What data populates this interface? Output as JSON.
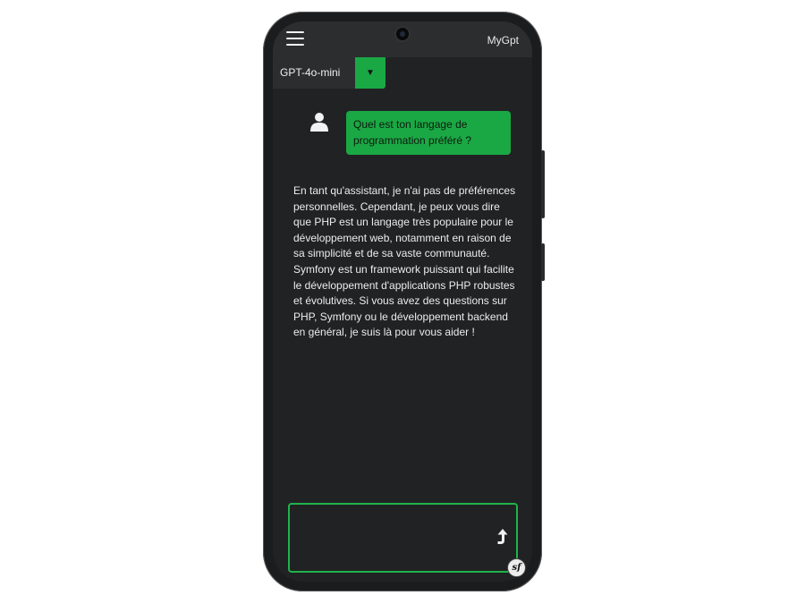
{
  "header": {
    "title": "MyGpt",
    "menu_icon": "hamburger-menu-icon"
  },
  "model_selector": {
    "selected": "GPT-4o-mini",
    "toggle_glyph": "▼"
  },
  "conversation": {
    "user_message": "Quel est ton langage de programmation préféré ?",
    "assistant_message": "En tant qu'assistant, je n'ai pas de préférences personnelles. Cependant, je peux vous dire que PHP est un langage très populaire pour le développement web, notamment en raison de sa simplicité et de sa vaste communauté. Symfony est un framework puissant qui facilite le développement d'applications PHP robustes et évolutives. Si vous avez des questions sur PHP, Symfony ou le développement backend en général, je suis là pour vous aider !"
  },
  "composer": {
    "value": "",
    "send_icon": "send-arrow-icon"
  },
  "badge": {
    "label": "sf",
    "icon": "symfony-logo-icon"
  },
  "colors": {
    "accent": "#1aa844",
    "background": "#212224",
    "surface": "#2c2d2f"
  }
}
